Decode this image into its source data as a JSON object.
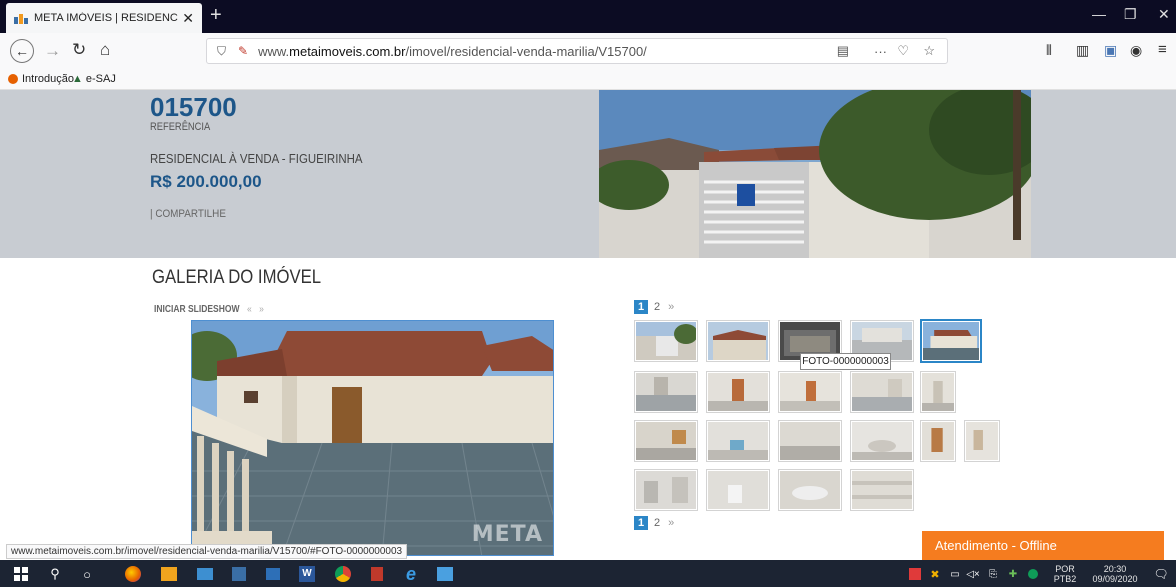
{
  "browser": {
    "tab_title": "META IMÓVEIS | RESIDENCIAL /",
    "tab_close": "✕",
    "new_tab": "+",
    "url_prefix": "www.",
    "url_host": "metaimoveis.com.br",
    "url_path": "/imovel/residencial-venda-marilia/V15700/",
    "bookmarks": [
      "Introdução",
      "e-SAJ"
    ],
    "status_url": "www.metaimoveis.com.br/imovel/residencial-venda-marilia/V15700/#FOTO-0000000003"
  },
  "property": {
    "reference": "015700",
    "reference_label": "REFERÊNCIA",
    "type_line": "RESIDENCIAL À VENDA - FIGUEIRINHA",
    "price": "R$ 200.000,00",
    "share": "| COMPARTILHE"
  },
  "gallery": {
    "title": "GALERIA DO IMÓVEL",
    "slideshow": "INICIAR SLIDESHOW",
    "prev": "«",
    "next": "»",
    "pages": [
      "1",
      "2"
    ],
    "pager_next": "»",
    "tooltip": "FOTO-0000000003",
    "watermark": "META"
  },
  "chat": {
    "label": "Atendimento - Offline"
  },
  "taskbar": {
    "lang_top": "POR",
    "lang_bottom": "PTB2",
    "time": "20:30",
    "date": "09/09/2020"
  }
}
